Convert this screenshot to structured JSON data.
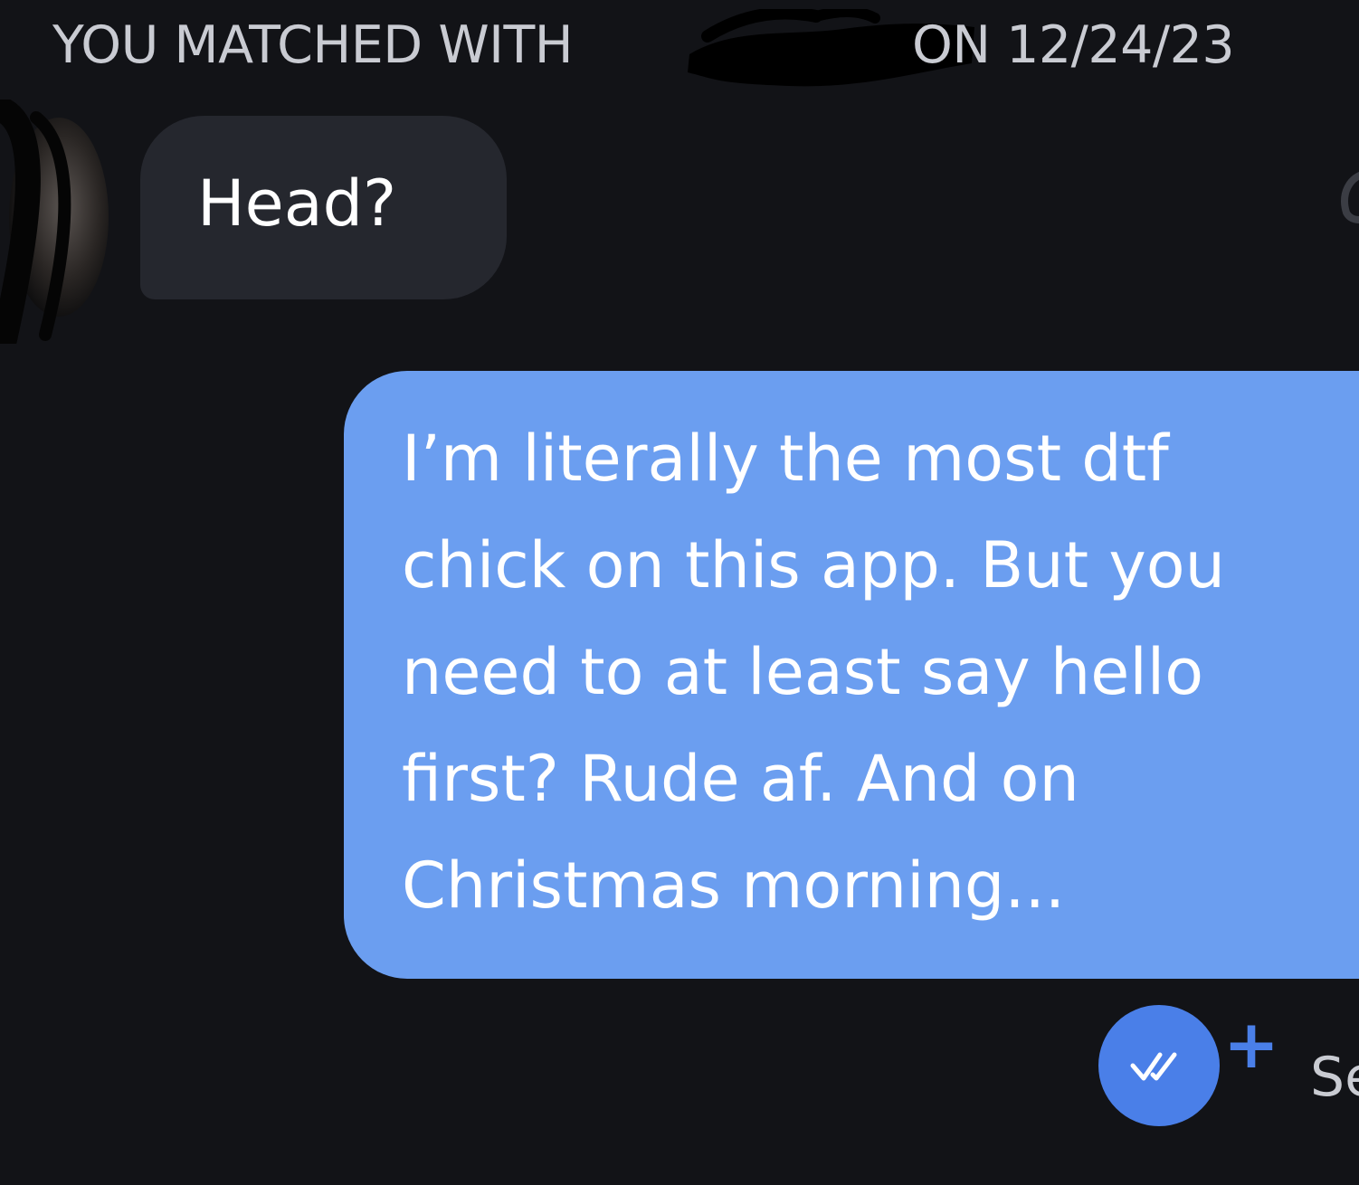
{
  "header": {
    "match_prefix": "YOU MATCHED WITH",
    "match_suffix": "ON 12/24/23"
  },
  "messages": [
    {
      "direction": "incoming",
      "text": "Head?"
    },
    {
      "direction": "outgoing",
      "lines": [
        "I’m literally the most dtf",
        "chick on this app. But you",
        "need to at least say hello",
        "first? Rude af. And on",
        "Christmas morning..."
      ]
    }
  ],
  "footer": {
    "plus_label": "+",
    "seen_label": "Se"
  },
  "colors": {
    "background": "#121317",
    "incoming_bubble": "#25272e",
    "outgoing_bubble": "#6b9ef0",
    "accent": "#4a7fe8"
  },
  "icons": {
    "read_receipt": "double-check-icon",
    "redaction": "redaction-scribble"
  }
}
